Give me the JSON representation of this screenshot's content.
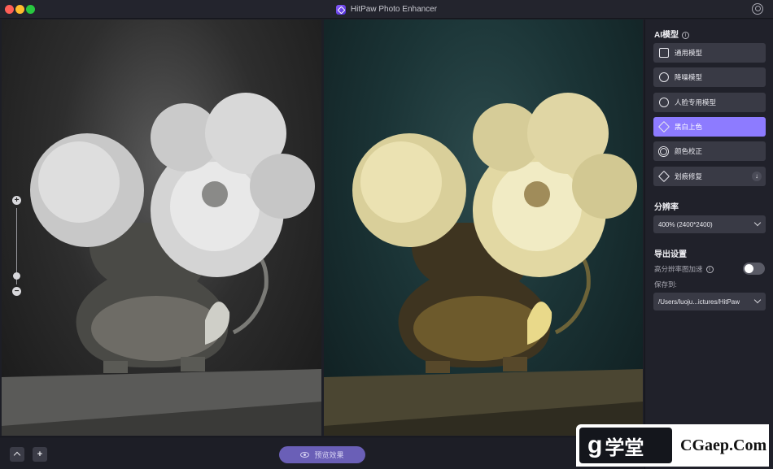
{
  "window": {
    "title": "HitPaw Photo Enhancer"
  },
  "zoom": {
    "plus_glyph": "+",
    "minus_glyph": "−"
  },
  "sidebar": {
    "ai_model_title": "AI模型",
    "models": [
      {
        "label": "通用模型",
        "icon": "image-icon",
        "active": false
      },
      {
        "label": "降噪模型",
        "icon": "denoise-icon",
        "active": false
      },
      {
        "label": "人脸专用模型",
        "icon": "face-icon",
        "active": false
      },
      {
        "label": "黑白上色",
        "icon": "paint-brush-icon",
        "active": true
      },
      {
        "label": "颜色校正",
        "icon": "sun-icon",
        "active": false
      },
      {
        "label": "划痕修复",
        "icon": "scratch-repair-icon",
        "active": false
      }
    ],
    "resolution": {
      "title": "分辨率",
      "value": "400% (2400*2400)"
    },
    "export": {
      "title": "导出设置",
      "gpu_label": "高分辨率图加速",
      "gpu_enabled": false,
      "save_to_label": "保存到:",
      "save_path": "/Users/luoju...ictures/HitPaw"
    }
  },
  "bottombar": {
    "preview_label": "预览效果"
  },
  "watermark": {
    "logo_g": "g",
    "logo_text": "学堂",
    "site": "CGaep.Com"
  },
  "colors": {
    "accent": "#8d7bff",
    "panel": "#20212a",
    "button": "#393a45"
  }
}
